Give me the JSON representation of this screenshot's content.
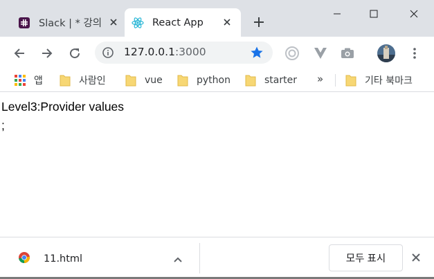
{
  "tabs": [
    {
      "title": "Slack | * 강의",
      "active": false
    },
    {
      "title": "React App",
      "active": true
    }
  ],
  "omnibox": {
    "host": "127.0.0.1",
    "port": ":3000"
  },
  "bookmarks": {
    "items": [
      {
        "label": "앱",
        "icon": "apps-icon"
      },
      {
        "label": "사람인",
        "icon": "folder-icon"
      },
      {
        "label": "vue",
        "icon": "folder-icon"
      },
      {
        "label": "python",
        "icon": "folder-icon"
      },
      {
        "label": "starter",
        "icon": "folder-icon"
      }
    ],
    "more": "»",
    "other": "기타 북마크"
  },
  "page": {
    "line1": "Level3:Provider values",
    "line2": ";"
  },
  "download": {
    "filename": "11.html",
    "show_all_label": "모두 표시"
  },
  "colors": {
    "tabstrip": "#dee1e6",
    "star": "#1a73e8",
    "folder": "#f7d774",
    "slack": "#4a154b",
    "react": "#61dafb"
  }
}
